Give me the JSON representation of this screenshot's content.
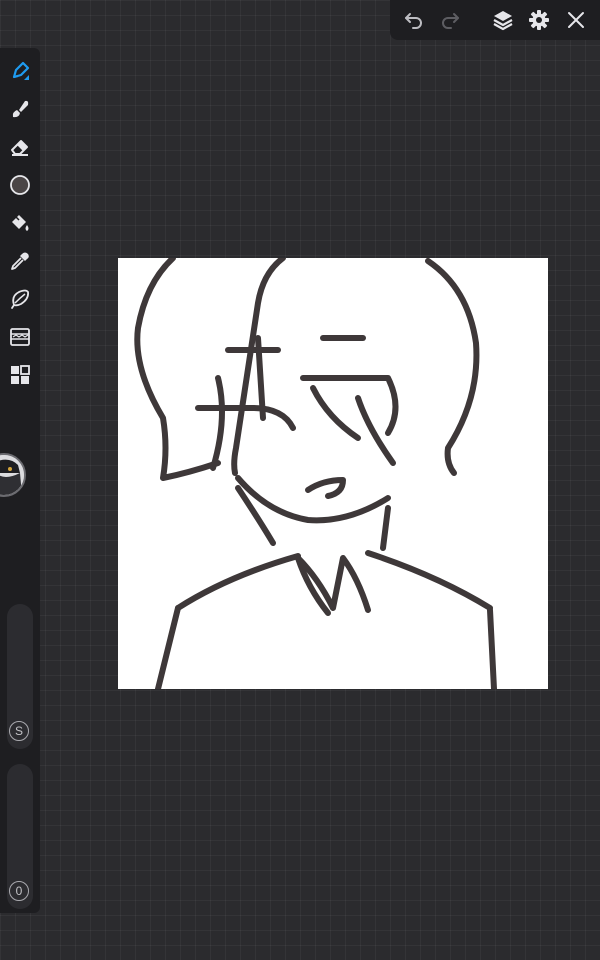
{
  "app": {
    "accent_color": "#1e9bf0",
    "toolbar_bg": "#1e1e21",
    "canvas_bg": "#ffffff"
  },
  "top_toolbar": {
    "buttons": [
      {
        "name": "undo",
        "icon": "undo-icon"
      },
      {
        "name": "redo",
        "icon": "redo-icon",
        "disabled": true
      },
      {
        "name": "layers",
        "icon": "layers-icon"
      },
      {
        "name": "settings",
        "icon": "gear-icon"
      },
      {
        "name": "close",
        "icon": "close-icon"
      }
    ]
  },
  "side_toolbar": {
    "tools": [
      {
        "name": "pen",
        "icon": "pen-icon",
        "selected": true
      },
      {
        "name": "brush",
        "icon": "brush-icon"
      },
      {
        "name": "eraser",
        "icon": "eraser-icon"
      },
      {
        "name": "color",
        "icon": "color-swatch-icon",
        "color": "#4a4546"
      },
      {
        "name": "fill",
        "icon": "paint-bucket-icon"
      },
      {
        "name": "eyedropper",
        "icon": "eyedropper-icon"
      },
      {
        "name": "lasso",
        "icon": "lasso-icon"
      },
      {
        "name": "filters",
        "icon": "filter-icon"
      },
      {
        "name": "materials",
        "icon": "grid-icon"
      }
    ],
    "size_slider": {
      "label": "S"
    },
    "opacity_slider": {
      "label": "0"
    }
  },
  "canvas": {
    "stroke_color": "#3e3839"
  }
}
